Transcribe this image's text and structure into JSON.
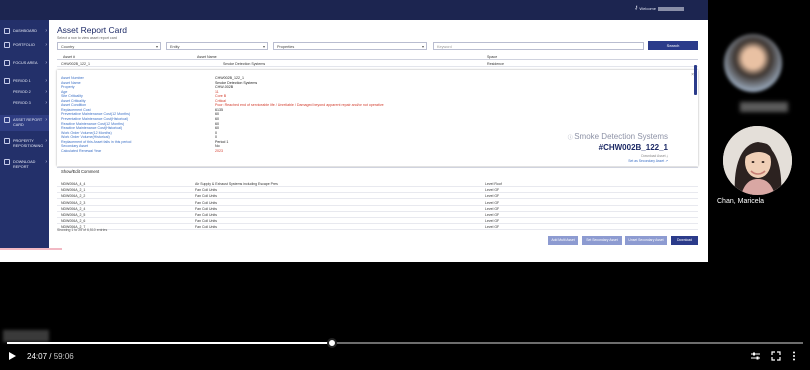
{
  "app": {
    "welcome": "Welcome"
  },
  "sidebar": {
    "items": [
      {
        "label": "DASHBOARD"
      },
      {
        "label": "PORTFOLIO"
      },
      {
        "label": "FOCUS AREA"
      },
      {
        "label": "PERIOD 1"
      },
      {
        "label": "PERIOD 2"
      },
      {
        "label": "PERIOD 3"
      },
      {
        "label": "ASSET REPORT"
      },
      {
        "label": "PROPERTY"
      },
      {
        "label": "DOWNLOAD"
      }
    ],
    "sub_card": "CARD",
    "sub_repositioning": "REPOSITIONING",
    "sub_report": "REPORT"
  },
  "page": {
    "title": "Asset Report Card",
    "subtitle": "Select a row to view asset report card"
  },
  "filters": {
    "country": "Country",
    "entity": "Entity",
    "properties": "Properties",
    "keyword_placeholder": "Keyword",
    "search_label": "Search"
  },
  "table": {
    "headers": [
      "Asset #",
      "Asset Name",
      "Space"
    ],
    "first_row": [
      "CHW002B_122_1",
      "Smoke Detection Systems",
      "Residence"
    ],
    "rows": [
      [
        "NDW006A_4_4",
        "Air Supply & Exhaust Systems including Escape Pres",
        "Level Roof"
      ],
      [
        "NDW006A_2_1",
        "Fan Coil Units",
        "Level GF"
      ],
      [
        "NDW006A_2_2",
        "Fan Coil Units",
        "Level GF"
      ],
      [
        "NDW006A_2_3",
        "Fan Coil Units",
        "Level GF"
      ],
      [
        "NDW006A_2_4",
        "Fan Coil Units",
        "Level GF"
      ],
      [
        "NDW006A_2_5",
        "Fan Coil Units",
        "Level GF"
      ],
      [
        "NDW006A_2_6",
        "Fan Coil Units",
        "Level GF"
      ],
      [
        "NDW006A_2_7",
        "Fan Coil Units",
        "Level GF"
      ]
    ],
    "entries": "Showing 1 to 25 of 6,510 entries"
  },
  "detail": {
    "fields": [
      {
        "label": "Asset Number",
        "value": "CHW002B_122_1",
        "red": false
      },
      {
        "label": "Asset Name",
        "value": "Smoke Detection Systems",
        "red": false
      },
      {
        "label": "Property",
        "value": "CHW-002B",
        "red": false
      },
      {
        "label": "Age",
        "value": "11",
        "red": true
      },
      {
        "label": "Site Criticality",
        "value": "Core B",
        "red": true
      },
      {
        "label": "Asset Criticality",
        "value": "Critical",
        "red": true
      },
      {
        "label": "Asset Condition",
        "value": "Poor: Reached end of serviceable life / Unreliable / Damaged beyond apparent repair and/or not operative",
        "red": true
      },
      {
        "label": "Replacement Cost",
        "value": "6135",
        "red": false
      },
      {
        "label": "Preventative Maintenance Cost(12 Months)",
        "value": "60",
        "red": false
      },
      {
        "label": "Preventative Maintenance Cost(Historical)",
        "value": "60",
        "red": false
      },
      {
        "label": "Reactive Maintenance Cost(12 Months)",
        "value": "60",
        "red": false
      },
      {
        "label": "Reactive Maintenance Cost(Historical)",
        "value": "60",
        "red": false
      },
      {
        "label": "Work Order Volume(12 Months)",
        "value": "0",
        "red": false
      },
      {
        "label": "Work Order Volume(Historical)",
        "value": "0",
        "red": false
      },
      {
        "label": "Replacement of this Asset falls in this period",
        "value": "Period 1",
        "red": false
      },
      {
        "label": "Secondary Asset",
        "value": "No",
        "red": false
      },
      {
        "label": "Calculated Renewal Year",
        "value": "2023",
        "red": true
      }
    ],
    "asset_title": "Smoke Detection Systems",
    "asset_code": "#CHW002B_122_1",
    "link_download": "Download Asset",
    "link_secondary": "Set as Secondary Asset",
    "show_comment": "Show/Edit Comment"
  },
  "footer_buttons": {
    "add_multi": "Add Multi Asset",
    "set_secondary": "Set Secondary Asset",
    "unset_secondary": "Unset Secondary Asset",
    "download": "Download"
  },
  "participants": {
    "person_name": "Chan, Maricela"
  },
  "player": {
    "current_time": "24:07",
    "duration": "59:06",
    "progress": 0.408
  },
  "colors": {
    "navy": "#1c2550",
    "sidebar": "#23306a",
    "accent": "#2b3b8a",
    "link": "#3b6fc5",
    "alert": "#d23a2a"
  }
}
